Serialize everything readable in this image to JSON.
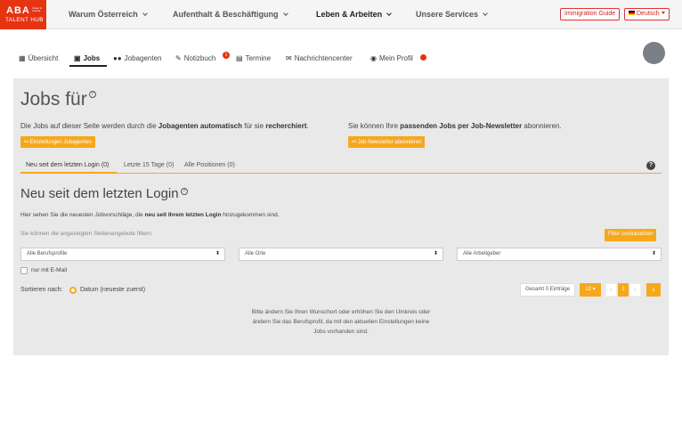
{
  "logo": {
    "line1": "ABA",
    "small": "Invest in Austria",
    "line2": "TALENT HUB"
  },
  "topnav": [
    {
      "label": "Warum Österreich"
    },
    {
      "label": "Aufenthalt & Beschäftigung"
    },
    {
      "label": "Leben & Arbeiten"
    },
    {
      "label": "Unsere Services"
    }
  ],
  "topbar": {
    "guide": "Immigration Guide",
    "language": "Deutsch"
  },
  "tabs": [
    {
      "label": "Übersicht",
      "icon": "grid-icon"
    },
    {
      "label": "Jobs",
      "icon": "briefcase-icon"
    },
    {
      "label": "Jobagenten",
      "icon": "binoculars-icon"
    },
    {
      "label": "Notizbuch",
      "icon": "pencil-icon",
      "badge": "1"
    },
    {
      "label": "Termine",
      "icon": "calendar-icon"
    },
    {
      "label": "Nachrichtencenter",
      "icon": "envelope-icon"
    },
    {
      "label": "Mein Profil",
      "icon": "user-icon"
    }
  ],
  "page": {
    "title": "Jobs für",
    "left_text_pre": "Die Jobs auf dieser Seite werden durch die ",
    "left_text_b1": "Jobagenten automatisch",
    "left_text_mid": " für sie ",
    "left_text_b2": "recherchiert",
    "left_text_post": ".",
    "left_button": "Einstellungen Jobagenten",
    "right_text_pre": "Sie können Ihre ",
    "right_text_b": "passenden Jobs per Job-Newsletter",
    "right_text_post": " abonnieren.",
    "right_button": "Job-Newsletter abonnieren"
  },
  "subtabs": [
    {
      "label": "Neu seit dem letzten Login (0)"
    },
    {
      "label": "Letzte 15 Tage (0)"
    },
    {
      "label": "Alle Positionen (0)"
    }
  ],
  "section": {
    "title": "Neu seit dem letzten Login",
    "desc_pre": "Hier sehen Sie die neuesten Jobvorschläge, die ",
    "desc_b": "neu seit Ihrem letzten Login",
    "desc_post": " hinzugekommen sind.",
    "filter_hint": "Sie können die angezeigten Stellenangebote filtern:",
    "reset_button": "Filter zurücksetzen",
    "select1": "Alle Berufsprofile",
    "select2": "Alle Orte",
    "select3": "Alle Arbeitgeber",
    "checkbox_label": "nur mit E-Mail",
    "sort_label": "Sortieren nach:",
    "sort_option": "Datum (neueste zuerst)",
    "total": "Gesamt 0 Einträge",
    "per_page": "12",
    "page": "1",
    "empty_message": "Bitte ändern Sie Ihren Wunschort oder erhöhen Sie den Umkreis oder\nändern Sie das Berufsprofil, da mit den aktuellen Einstellungen keine\nJobs vorhanden sind."
  },
  "colors": {
    "brand": "#e63312",
    "accent": "#f6a81c",
    "panel": "#e9e9e9"
  }
}
